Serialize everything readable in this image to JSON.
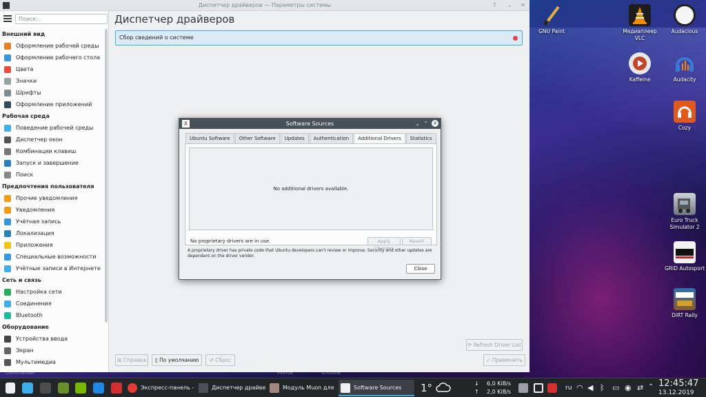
{
  "window": {
    "title": "Диспетчер драйверов — Параметры системы",
    "help_glyph": "?",
    "min_glyph": "⌄",
    "close_glyph": "✕"
  },
  "sidebar": {
    "search_placeholder": "Поиск...",
    "sections": [
      {
        "title": "Внешний вид",
        "items": [
          "Оформление рабочей среды",
          "Оформление рабочего стола",
          "Цвета",
          "Значки",
          "Шрифты",
          "Оформление приложений"
        ]
      },
      {
        "title": "Рабочая среда",
        "items": [
          "Поведение рабочей среды",
          "Диспетчер окон",
          "Комбинации клавиш",
          "Запуск и завершение",
          "Поиск"
        ]
      },
      {
        "title": "Предпочтения пользователя",
        "items": [
          "Прочие уведомления",
          "Уведомления",
          "Учётная запись",
          "Локализация",
          "Приложения",
          "Специальные возможности",
          "Учётные записи в Интернете"
        ]
      },
      {
        "title": "Сеть и связь",
        "items": [
          "Настройка сети",
          "Соединения",
          "Bluetooth"
        ]
      },
      {
        "title": "Оборудование",
        "items": [
          "Устройства ввода",
          "Экран",
          "Мультимедиа"
        ]
      }
    ]
  },
  "main": {
    "page_title": "Диспетчер драйверов",
    "message": "Сбор сведений о системе",
    "refresh": "Refresh Driver List",
    "help": "Справка",
    "defaults": "По умолчанию",
    "reset": "Сброс",
    "apply": "Применить"
  },
  "dialog": {
    "title": "Software Sources",
    "tabs": [
      "Ubuntu Software",
      "Other Software",
      "Updates",
      "Authentication",
      "Additional Drivers",
      "Statistics"
    ],
    "active_tab": "Additional Drivers",
    "empty_text": "No additional drivers available.",
    "proprietary_text": "No proprietary drivers are in use.",
    "apply_changes": "Apply Changes",
    "revert": "Revert",
    "note": "A proprietary driver has private code that Ubuntu developers can't review or improve. Security and other updates are dependent on the driver vendor.",
    "close": "Close"
  },
  "desktop": {
    "icons": [
      {
        "label": "GNU Paint"
      },
      {
        "label": "Медиаплеер VLC"
      },
      {
        "label": "Audacious"
      },
      {
        "label": "Kaffeine"
      },
      {
        "label": "Audacity"
      },
      {
        "label": "Cozy"
      },
      {
        "label": "Euro Truck Simulator 2"
      },
      {
        "label": "GRID Autosport"
      },
      {
        "label": "DiRT Rally"
      }
    ],
    "ghost_labels": [
      "Commander",
      "Firefox",
      "Chrome"
    ]
  },
  "taskbar": {
    "tasks": [
      {
        "label": "Экспресс-панель - ..."
      },
      {
        "label": "Диспетчер драйве..."
      },
      {
        "label": "Модуль Muon для ..."
      },
      {
        "label": "Software Sources"
      }
    ],
    "weather_temp": "1°",
    "net_down": "6,0 KiB/s",
    "net_up": "2,0 KiB/s",
    "layout": "ru",
    "time": "12:45:47",
    "date": "13.12.2019"
  },
  "colors": {
    "accent": "#3daee9",
    "panel": "#232629",
    "error": "#da4453"
  }
}
